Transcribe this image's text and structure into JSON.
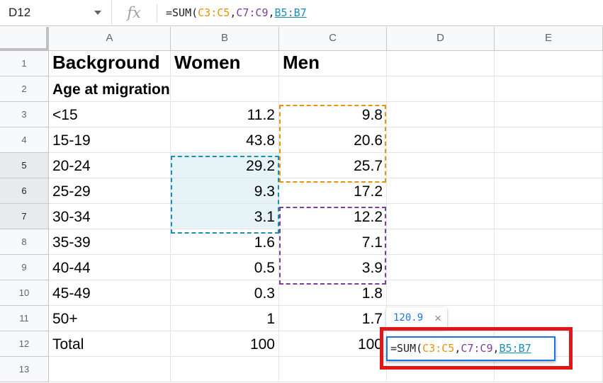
{
  "formula_bar": {
    "cell_ref": "D12",
    "fx_label": "fx",
    "formula": {
      "prefix": "=SUM(",
      "range1": "C3:C5",
      "sep1": ",",
      "range2": "C7:C9",
      "sep2": ",",
      "range3": "B5:B7"
    }
  },
  "columns": [
    "A",
    "B",
    "C",
    "D",
    "E"
  ],
  "rows": [
    "1",
    "2",
    "3",
    "4",
    "5",
    "6",
    "7",
    "8",
    "9",
    "10",
    "11",
    "12",
    "13"
  ],
  "cells": {
    "A1": "Background",
    "B1": "Women",
    "C1": "Men",
    "A2": "Age at migration",
    "A3": "<15",
    "B3": "11.2",
    "C3": "9.8",
    "A4": "15-19",
    "B4": "43.8",
    "C4": "20.6",
    "A5": "20-24",
    "B5": "29.2",
    "C5": "25.7",
    "A6": "25-29",
    "B6": "9.3",
    "C6": "17.2",
    "A7": "30-34",
    "B7": "3.1",
    "C7": "12.2",
    "A8": "35-39",
    "B8": "1.6",
    "C8": "7.1",
    "A9": "40-44",
    "B9": "0.5",
    "C9": "3.9",
    "A10": "45-49",
    "B10": "0.3",
    "C10": "1.8",
    "A11": "50+",
    "B11": "1",
    "C11": "1.7",
    "A12": "Total",
    "B12": "100",
    "C12": "100"
  },
  "editor": {
    "preview_value": "120.9",
    "close_symbol": "×"
  },
  "colors": {
    "range1": "#e8930c",
    "range2": "#7b3e9a",
    "range3": "#1b8fb3",
    "highlight_box": "#e0161b",
    "active_border": "#1a73e8"
  }
}
